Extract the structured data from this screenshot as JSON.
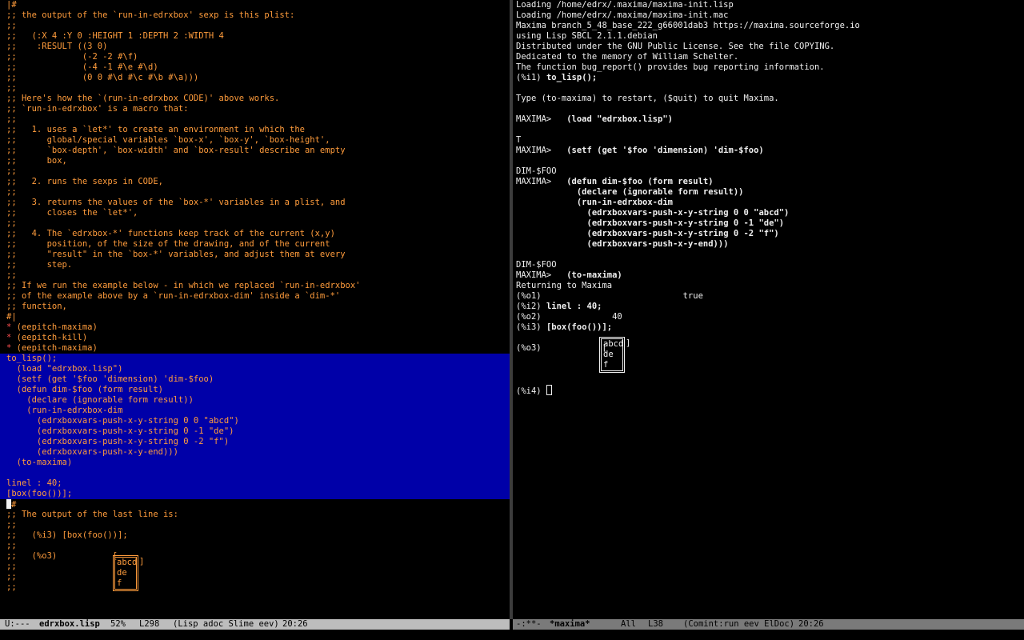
{
  "left_lines": [
    {
      "t": "|#",
      "c": "c"
    },
    {
      "t": ";; the output of the `run-in-edrxbox' sexp is this plist:",
      "c": "c"
    },
    {
      "t": ";;",
      "c": "c"
    },
    {
      "t": ";;   (:X 4 :Y 0 :HEIGHT 1 :DEPTH 2 :WIDTH 4",
      "c": "c"
    },
    {
      "t": ";;    :RESULT ((3 0)",
      "c": "c"
    },
    {
      "t": ";;             (-2 -2 #\\f)",
      "c": "c"
    },
    {
      "t": ";;             (-4 -1 #\\e #\\d)",
      "c": "c"
    },
    {
      "t": ";;             (0 0 #\\d #\\c #\\b #\\a)))",
      "c": "c"
    },
    {
      "t": ";;",
      "c": "c"
    },
    {
      "t": ";; Here's how the `(run-in-edrxbox CODE)' above works.",
      "c": "c"
    },
    {
      "t": ";; `run-in-edrxbox' is a macro that:",
      "c": "c"
    },
    {
      "t": ";;",
      "c": "c"
    },
    {
      "t": ";;   1. uses a `let*' to create an environment in which the",
      "c": "c"
    },
    {
      "t": ";;      global/special variables `box-x', `box-y', `box-height',",
      "c": "c"
    },
    {
      "t": ";;      `box-depth', `box-width' and `box-result' describe an empty",
      "c": "c"
    },
    {
      "t": ";;      box,",
      "c": "c"
    },
    {
      "t": ";;",
      "c": "c"
    },
    {
      "t": ";;   2. runs the sexps in CODE,",
      "c": "c"
    },
    {
      "t": ";;",
      "c": "c"
    },
    {
      "t": ";;   3. returns the values of the `box-*' variables in a plist, and",
      "c": "c"
    },
    {
      "t": ";;      closes the `let*',",
      "c": "c"
    },
    {
      "t": ";;",
      "c": "c"
    },
    {
      "t": ";;   4. The `edrxbox-*' functions keep track of the current (x,y)",
      "c": "c"
    },
    {
      "t": ";;      position, of the size of the drawing, and of the current",
      "c": "c"
    },
    {
      "t": ";;      \"result\" in the `box-*' variables, and adjust them at every",
      "c": "c"
    },
    {
      "t": ";;      step.",
      "c": "c"
    },
    {
      "t": ";;",
      "c": "c"
    },
    {
      "t": ";; If we run the example below - in which we replaced `run-in-edrxbox'",
      "c": "c"
    },
    {
      "t": ";; of the example above by a `run-in-edrxbox-dim' inside a `dim-*'",
      "c": "c"
    },
    {
      "t": ";; function,",
      "c": "c"
    },
    {
      "t": "#|",
      "c": "c"
    },
    {
      "t": "* (eepitch-maxima)",
      "c": "c",
      "star": true
    },
    {
      "t": "* (eepitch-kill)",
      "c": "c",
      "star": true
    },
    {
      "t": "* (eepitch-maxima)",
      "c": "c",
      "star": true
    },
    {
      "t": "to_lisp();",
      "c": "c",
      "hl": true
    },
    {
      "t": "  (load \"edrxbox.lisp\")",
      "c": "c",
      "hl": true
    },
    {
      "t": "  (setf (get '$foo 'dimension) 'dim-$foo)",
      "c": "c",
      "hl": true
    },
    {
      "t": "  (defun dim-$foo (form result)",
      "c": "c",
      "hl": true
    },
    {
      "t": "    (declare (ignorable form result))",
      "c": "c",
      "hl": true
    },
    {
      "t": "    (run-in-edrxbox-dim",
      "c": "c",
      "hl": true
    },
    {
      "t": "      (edrxboxvars-push-x-y-string 0 0 \"abcd\")",
      "c": "c",
      "hl": true
    },
    {
      "t": "      (edrxboxvars-push-x-y-string 0 -1 \"de\")",
      "c": "c",
      "hl": true
    },
    {
      "t": "      (edrxboxvars-push-x-y-string 0 -2 \"f\")",
      "c": "c",
      "hl": true
    },
    {
      "t": "      (edrxboxvars-push-x-y-end)))",
      "c": "c",
      "hl": true
    },
    {
      "t": "  (to-maxima)",
      "c": "c",
      "hl": true
    },
    {
      "t": "",
      "c": "c",
      "hl": true
    },
    {
      "t": "linel : 40;",
      "c": "c",
      "hl": true
    },
    {
      "t": "[box(foo())];",
      "c": "c",
      "hl": true
    },
    {
      "t": "#",
      "c": "c",
      "cursor": true
    },
    {
      "t": ";; The output of the last line is:",
      "c": "c"
    },
    {
      "t": ";;",
      "c": "c"
    },
    {
      "t": ";;   (%i3) [box(foo())];",
      "c": "c"
    },
    {
      "t": ";;",
      "c": "c"
    },
    {
      "t": ";;   (%o3)           [ ",
      "c": "c"
    },
    {
      "t": ";;",
      "c": "c"
    },
    {
      "t": ";;",
      "c": "c"
    },
    {
      "t": ";;",
      "c": "c"
    }
  ],
  "left_box": {
    "lines": [
      "abcd",
      "de",
      "f"
    ],
    "close": "]"
  },
  "right_lines": [
    {
      "t": "Loading /home/edrx/.maxima/maxima-init.lisp",
      "c": "w"
    },
    {
      "t": "Loading /home/edrx/.maxima/maxima-init.mac",
      "c": "w"
    },
    {
      "t": "Maxima branch_5_48_base_222_g66001dab3 https://maxima.sourceforge.io",
      "c": "w"
    },
    {
      "t": "using Lisp SBCL 2.1.1.debian",
      "c": "w"
    },
    {
      "t": "Distributed under the GNU Public License. See the file COPYING.",
      "c": "w"
    },
    {
      "t": "Dedicated to the memory of William Schelter.",
      "c": "w"
    },
    {
      "t": "The function bug_report() provides bug reporting information.",
      "c": "w"
    },
    {
      "t": "(%i1) ",
      "c": "w",
      "bold_tail": "to_lisp();"
    },
    {
      "t": "",
      "c": "w"
    },
    {
      "t": "Type (to-maxima) to restart, ($quit) to quit Maxima.",
      "c": "w"
    },
    {
      "t": "",
      "c": "w"
    },
    {
      "t": "MAXIMA>   ",
      "c": "w",
      "bold_tail": "(load \"edrxbox.lisp\")"
    },
    {
      "t": "",
      "c": "w"
    },
    {
      "t": "T",
      "c": "w"
    },
    {
      "t": "MAXIMA>   ",
      "c": "w",
      "bold_tail": "(setf (get '$foo 'dimension) 'dim-$foo)"
    },
    {
      "t": "",
      "c": "w"
    },
    {
      "t": "DIM-$FOO",
      "c": "w"
    },
    {
      "t": "MAXIMA>   ",
      "c": "w",
      "bold_tail": "(defun dim-$foo (form result)"
    },
    {
      "t": "            ",
      "c": "w",
      "bold_tail": "(declare (ignorable form result))"
    },
    {
      "t": "            ",
      "c": "w",
      "bold_tail": "(run-in-edrxbox-dim"
    },
    {
      "t": "              ",
      "c": "w",
      "bold_tail": "(edrxboxvars-push-x-y-string 0 0 \"abcd\")"
    },
    {
      "t": "              ",
      "c": "w",
      "bold_tail": "(edrxboxvars-push-x-y-string 0 -1 \"de\")"
    },
    {
      "t": "              ",
      "c": "w",
      "bold_tail": "(edrxboxvars-push-x-y-string 0 -2 \"f\")"
    },
    {
      "t": "              ",
      "c": "w",
      "bold_tail": "(edrxboxvars-push-x-y-end)))"
    },
    {
      "t": "",
      "c": "w"
    },
    {
      "t": "DIM-$FOO",
      "c": "w"
    },
    {
      "t": "MAXIMA>   ",
      "c": "w",
      "bold_tail": "(to-maxima)"
    },
    {
      "t": "Returning to Maxima",
      "c": "w"
    },
    {
      "t": "(%o1)                            true",
      "c": "w"
    },
    {
      "t": "(%i2) ",
      "c": "w",
      "bold_tail": "linel : 40;"
    },
    {
      "t": "(%o2)              40",
      "c": "w"
    },
    {
      "t": "(%i3) ",
      "c": "w",
      "bold_tail": "[box(foo())];"
    },
    {
      "t": "",
      "c": "w"
    },
    {
      "t": "(%o3)            [ ",
      "c": "w"
    },
    {
      "t": "",
      "c": "w"
    },
    {
      "t": "",
      "c": "w"
    },
    {
      "t": "",
      "c": "w"
    },
    {
      "t": "(%i4) ",
      "c": "w",
      "hollow": true
    }
  ],
  "right_box": {
    "lines": [
      "abcd",
      "de",
      "f"
    ],
    "close": "]"
  },
  "modeline_left": {
    "status": "U:---",
    "buffer": "edrxbox.lisp",
    "percent": "52%",
    "line": "L298",
    "modes": "(Lisp adoc Slime eev)",
    "time": "20:26"
  },
  "modeline_right": {
    "status": "-:**-",
    "buffer": "*maxima*",
    "percent": "All",
    "line": "L38",
    "modes": "(Comint:run eev ElDoc)",
    "time": "20:26"
  }
}
